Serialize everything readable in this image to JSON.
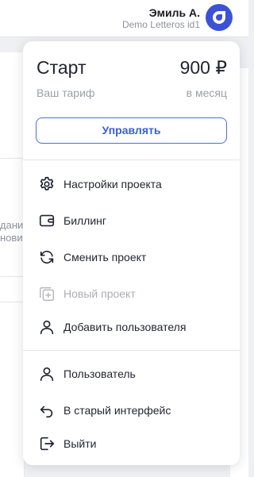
{
  "header": {
    "user_name": "Эмиль А.",
    "org_name": "Demo Letteros id1"
  },
  "background": {
    "partial_text_1": "дани",
    "partial_text_2": "нови"
  },
  "plan": {
    "name": "Старт",
    "price": "900 ₽",
    "subtitle": "Ваш тариф",
    "period": "в месяц",
    "manage_label": "Управлять"
  },
  "menu": {
    "project_settings": "Настройки проекта",
    "billing": "Биллинг",
    "switch_project": "Сменить проект",
    "new_project": "Новый проект",
    "add_user": "Добавить пользователя",
    "user": "Пользователь",
    "old_interface": "В старый интерфейс",
    "logout": "Выйти"
  },
  "colors": {
    "accent": "#3c52d6",
    "button_text": "#3a5fd9",
    "disabled": "#a8adb6"
  }
}
